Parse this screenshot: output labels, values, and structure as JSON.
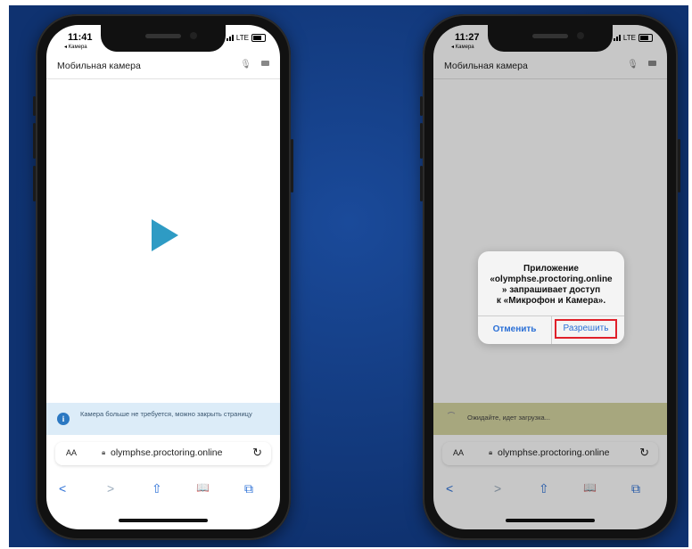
{
  "left_phone": {
    "time": "11:41",
    "back_app": "◂ Камера",
    "network": "LTE",
    "header_title": "Мобильная камера",
    "notice": "Камера больше не требуется, можно закрыть страницу",
    "addr_aa": "AA",
    "url": "olymphse.proctoring.online",
    "toolbar": {
      "back": "<",
      "forward": ">",
      "share": "⇧",
      "bookmarks": "📖",
      "tabs": "⧉"
    }
  },
  "right_phone": {
    "time": "11:27",
    "back_app": "◂ Камера",
    "network": "LTE",
    "header_title": "Мобильная камера",
    "dialog": {
      "message": "Приложение\n«olymphse.proctoring.online\n» запрашивает доступ\nк «Микрофон и Камера».",
      "deny": "Отменить",
      "allow": "Разрешить"
    },
    "notice": "Ожидайте, идет загрузка...",
    "addr_aa": "AA",
    "url": "olymphse.proctoring.online",
    "toolbar": {
      "back": "<",
      "forward": ">",
      "share": "⇧",
      "bookmarks": "📖",
      "tabs": "⧉"
    }
  },
  "colors": {
    "background": "#0f3270",
    "play": "#2e9bc4",
    "highlight": "#e0202a",
    "link": "#2a6fd6"
  }
}
